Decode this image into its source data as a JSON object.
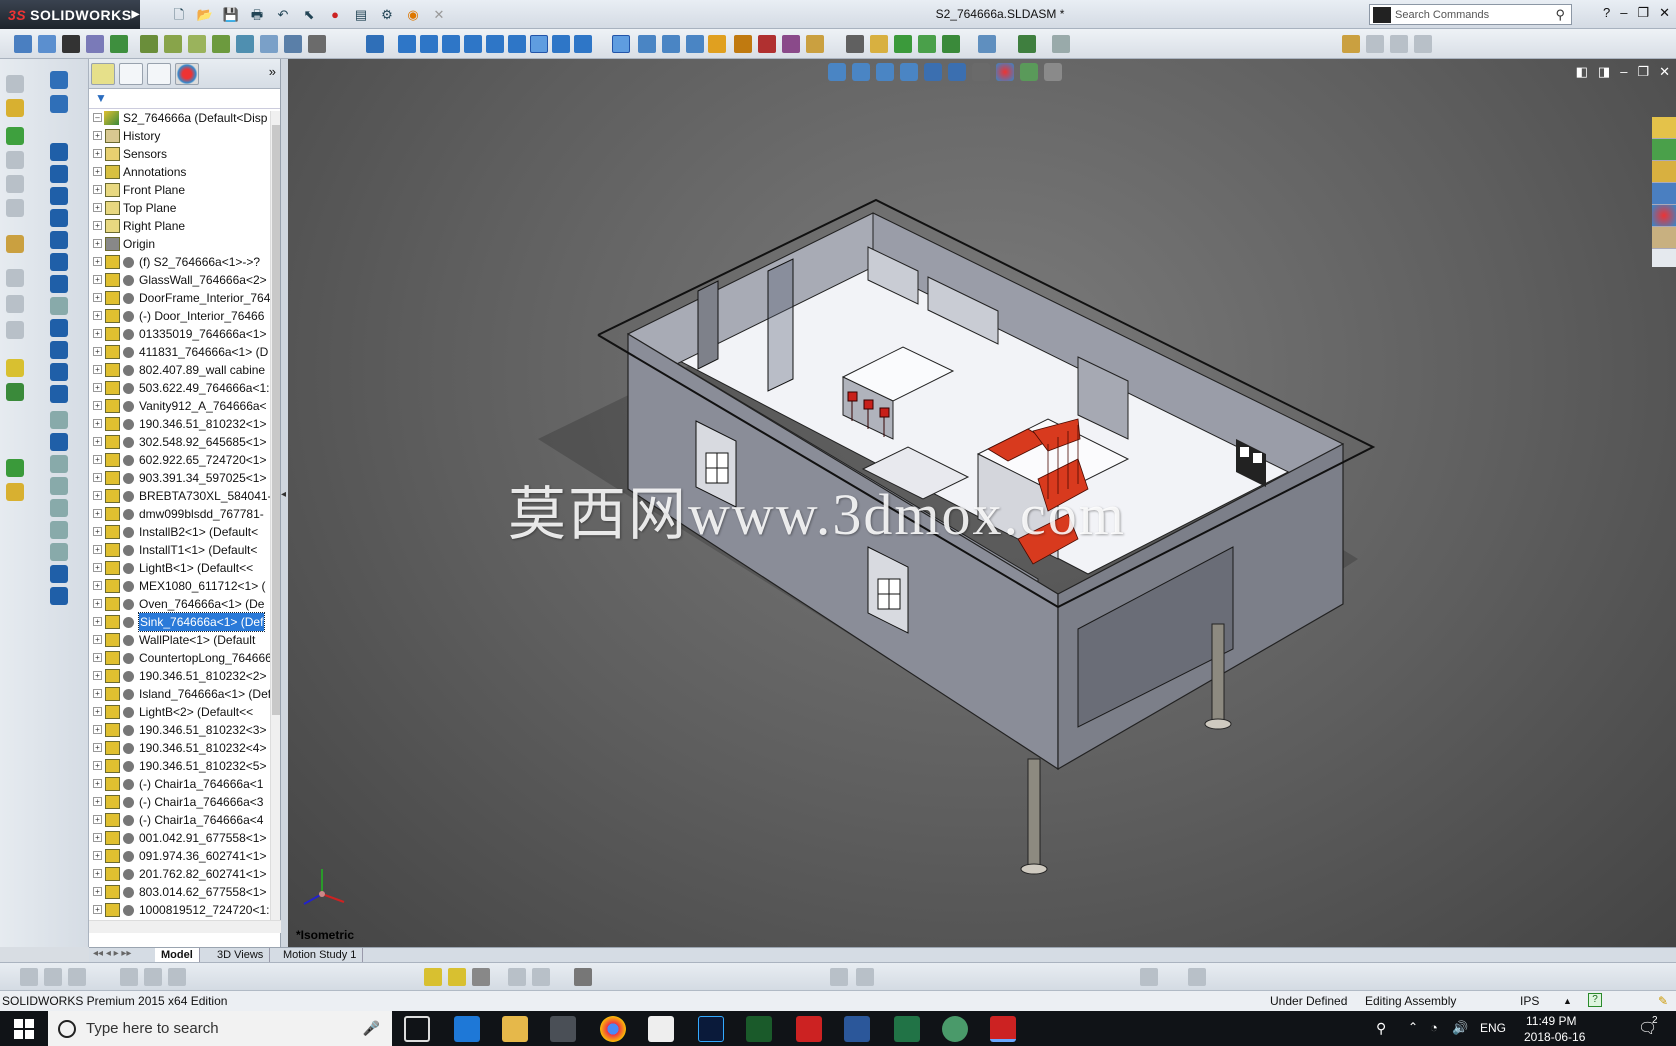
{
  "app": {
    "logo_prefix": "3S",
    "logo_text": "SOLIDWORKS",
    "document_title": "S2_764666a.SLDASM *",
    "search_placeholder": "Search Commands"
  },
  "feature_tree": {
    "root": "S2_764666a  (Default<Disp",
    "items": [
      {
        "label": "History",
        "icon": "history-icon"
      },
      {
        "label": "Sensors",
        "icon": "sensors-icon"
      },
      {
        "label": "Annotations",
        "icon": "annotations-icon"
      },
      {
        "label": "Front Plane",
        "icon": "plane-icon"
      },
      {
        "label": "Top Plane",
        "icon": "plane-icon"
      },
      {
        "label": "Right Plane",
        "icon": "plane-icon"
      },
      {
        "label": "Origin",
        "icon": "origin-icon"
      },
      {
        "label": "(f) S2_764666a<1>->?",
        "icon": "subassembly-icon"
      },
      {
        "label": "GlassWall_764666a<2> (D",
        "icon": "component-icon"
      },
      {
        "label": "DoorFrame_Interior_76466",
        "icon": "component-icon"
      },
      {
        "label": "(-) Door_Interior_76466",
        "icon": "component-icon"
      },
      {
        "label": "01335019_764666a<1>",
        "icon": "component-icon"
      },
      {
        "label": "411831_764666a<1> (D",
        "icon": "component-icon"
      },
      {
        "label": "802.407.89_wall cabine",
        "icon": "component-icon"
      },
      {
        "label": "503.622.49_764666a<1:",
        "icon": "component-icon"
      },
      {
        "label": "Vanity912_A_764666a<",
        "icon": "component-icon"
      },
      {
        "label": "190.346.51_810232<1>",
        "icon": "component-icon"
      },
      {
        "label": "302.548.92_645685<1>",
        "icon": "component-icon"
      },
      {
        "label": "602.922.65_724720<1>",
        "icon": "component-icon"
      },
      {
        "label": "903.391.34_597025<1>",
        "icon": "component-icon"
      },
      {
        "label": "BREBTA730XL_584041-",
        "icon": "component-icon"
      },
      {
        "label": "dmw099blsdd_767781-",
        "icon": "component-icon"
      },
      {
        "label": "InstallB2<1> (Default<",
        "icon": "component-icon"
      },
      {
        "label": "InstallT1<1> (Default<",
        "icon": "component-icon"
      },
      {
        "label": "LightB<1> (Default<<",
        "icon": "component-icon"
      },
      {
        "label": "MEX1080_611712<1> (",
        "icon": "component-icon"
      },
      {
        "label": "Oven_764666a<1> (De",
        "icon": "component-icon"
      },
      {
        "label": "Sink_764666a<1> (Def",
        "icon": "component-icon",
        "selected": true
      },
      {
        "label": "WallPlate<1> (Default",
        "icon": "component-icon"
      },
      {
        "label": "CountertopLong_764666a",
        "icon": "component-icon"
      },
      {
        "label": "190.346.51_810232<2>",
        "icon": "component-icon"
      },
      {
        "label": "Island_764666a<1> (Defau",
        "icon": "component-icon"
      },
      {
        "label": "LightB<2> (Default<<",
        "icon": "component-icon"
      },
      {
        "label": "190.346.51_810232<3>",
        "icon": "component-icon"
      },
      {
        "label": "190.346.51_810232<4>",
        "icon": "component-icon"
      },
      {
        "label": "190.346.51_810232<5>",
        "icon": "component-icon"
      },
      {
        "label": "(-) Chair1a_764666a<1",
        "icon": "component-icon"
      },
      {
        "label": "(-) Chair1a_764666a<3",
        "icon": "component-icon"
      },
      {
        "label": "(-) Chair1a_764666a<4",
        "icon": "component-icon"
      },
      {
        "label": "001.042.91_677558<1>",
        "icon": "component-icon"
      },
      {
        "label": "091.974.36_602741<1>",
        "icon": "component-icon"
      },
      {
        "label": "201.762.82_602741<1>",
        "icon": "component-icon"
      },
      {
        "label": "803.014.62_677558<1>",
        "icon": "component-icon"
      },
      {
        "label": "1000819512_724720<1:",
        "icon": "component-icon"
      }
    ]
  },
  "viewport": {
    "view_name": "*Isometric",
    "watermark": "莫西网www.3dmox.com"
  },
  "bottom_tabs": [
    "Model",
    "3D Views",
    "Motion Study 1"
  ],
  "status": {
    "edition": "SOLIDWORKS Premium 2015 x64 Edition",
    "definition": "Under Defined",
    "mode": "Editing Assembly",
    "units": "IPS"
  },
  "taskbar": {
    "search_placeholder": "Type here to search",
    "language": "ENG",
    "time": "11:49 PM",
    "date": "2018-06-16",
    "notification_count": "2"
  },
  "colors": {
    "viewport_bg": "#5e5e5e",
    "model_wall": "#8c8f99",
    "stair_red": "#d83a1e",
    "selection": "#2a7ad9"
  }
}
